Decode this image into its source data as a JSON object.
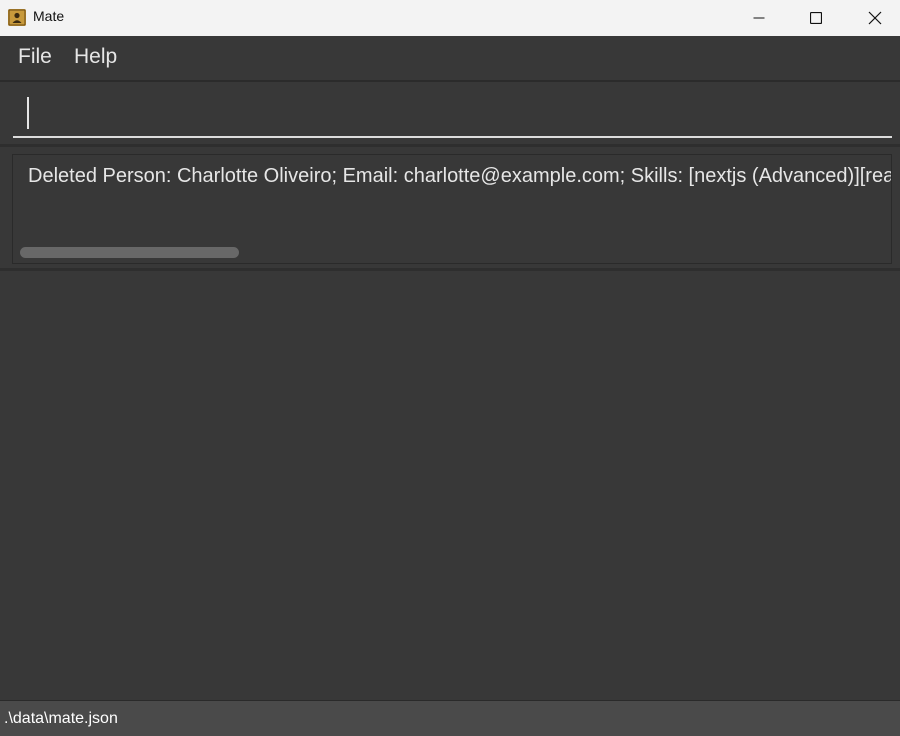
{
  "window": {
    "title": "Mate",
    "icon": "address-book-icon",
    "controls": [
      "minimize-icon",
      "maximize-icon",
      "close-icon"
    ]
  },
  "menu": {
    "file_label": "File",
    "help_label": "Help"
  },
  "command": {
    "value": "",
    "placeholder": ""
  },
  "result": {
    "message": "Deleted Person: Charlotte Oliveiro; Email: charlotte@example.com; Skills: [nextjs (Advanced)][react"
  },
  "status": {
    "file_path": ".\\data\\mate.json"
  },
  "colors": {
    "background": "#383838",
    "titlebar": "#f3f3f3",
    "statusbar": "#4a4a4a",
    "text": "#e6e6e6",
    "scrollbar_thumb": "#686868"
  }
}
